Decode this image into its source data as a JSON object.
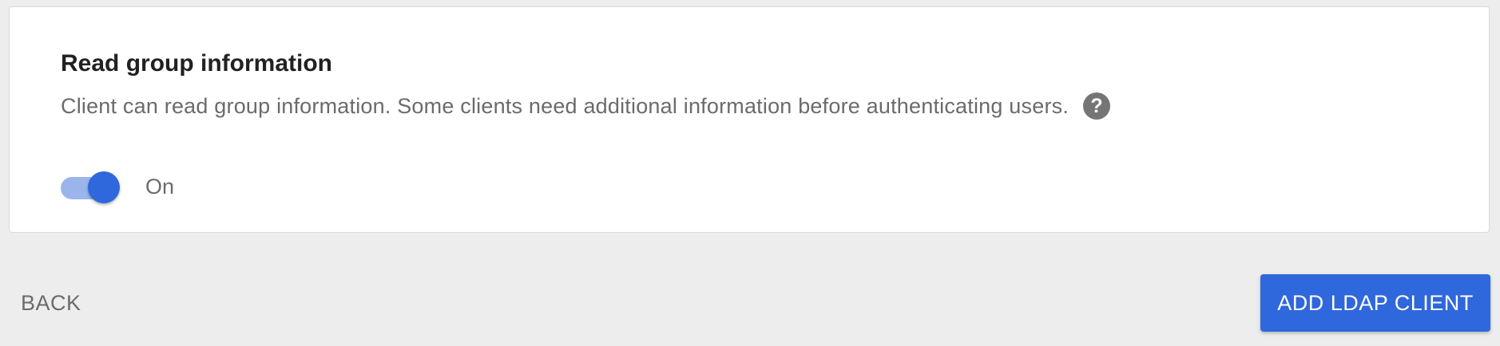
{
  "setting": {
    "title": "Read group information",
    "description": "Client can read group information. Some clients need additional information before authenticating users.",
    "help_icon": "?",
    "toggle": {
      "state": "on",
      "label": "On"
    }
  },
  "footer": {
    "back_label": "BACK",
    "primary_label": "ADD LDAP CLIENT"
  },
  "colors": {
    "accent": "#2f67dc",
    "track": "#9bb5ec",
    "background": "#ededed",
    "text_secondary": "#6b6b6b"
  },
  "icons": {
    "help": "help-circle-icon"
  }
}
